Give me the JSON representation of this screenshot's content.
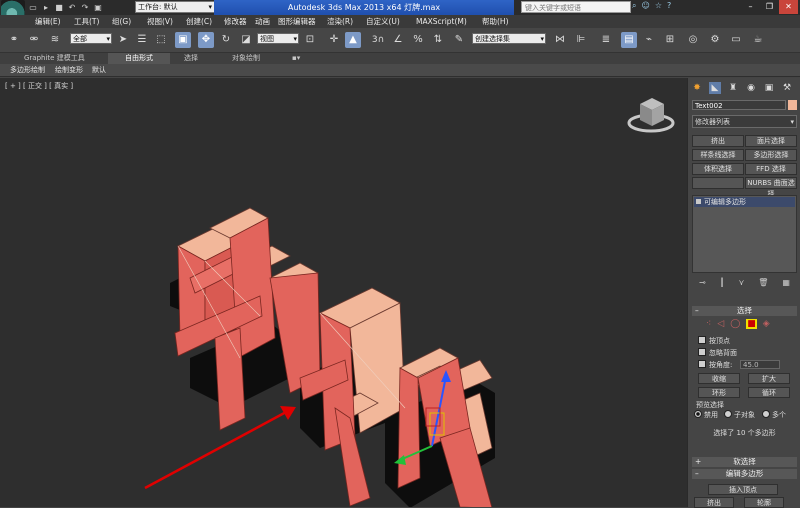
{
  "titlebar": {
    "workspace": "工作台: 默认",
    "title": "Autodesk 3ds Max  2013 x64     灯牌.max",
    "search_placeholder": "键入关键字或短语"
  },
  "menu": [
    "编辑(E)",
    "工具(T)",
    "组(G)",
    "视图(V)",
    "创建(C)",
    "修改器",
    "动画",
    "图形编辑器",
    "渲染(R)",
    "自定义(U)",
    "MAXScript(M)",
    "帮助(H)"
  ],
  "toolbar": {
    "selection_filter": "全部",
    "ref_coord": "视图",
    "named_selection": "创建选择集",
    "snap_label": "3"
  },
  "ribbon": {
    "tabs": [
      "Graphite 建模工具",
      "自由形式",
      "选择",
      "对象绘制"
    ],
    "subtabs": [
      "多边形绘制",
      "绘制变形",
      "默认"
    ]
  },
  "viewport": {
    "label": "[ + ] [ 正交 ] [ 真实 ]",
    "text_color": "#e2645c",
    "side_color": "#f2b79a"
  },
  "panel": {
    "object_name": "Text002",
    "object_color": "#f2b79a",
    "modifier_list": "修改器列表",
    "mod_buttons": [
      "挤出",
      "面片选择",
      "样条线选择",
      "多边形选择",
      "体积选择",
      "FFD 选择",
      "",
      "NURBS 曲面选择"
    ],
    "stack_item": "可编辑多边形",
    "selection_rollout": {
      "title": "选择",
      "by_vertex": "按顶点",
      "ignore_back": "忽略背面",
      "by_angle": "按角度:",
      "angle_value": "45.0",
      "shrink": "收缩",
      "grow": "扩大",
      "ring": "环形",
      "loop": "循环",
      "preview": "预览选择",
      "disable": "禁用",
      "subobject": "子对象",
      "multi": "多个",
      "status": "选择了 10 个多边形"
    },
    "soft_selection": "软选择",
    "edit_polygons": "编辑多边形",
    "insert_vertex": "插入顶点",
    "extrude": "挤出",
    "outline": "轮廓"
  }
}
